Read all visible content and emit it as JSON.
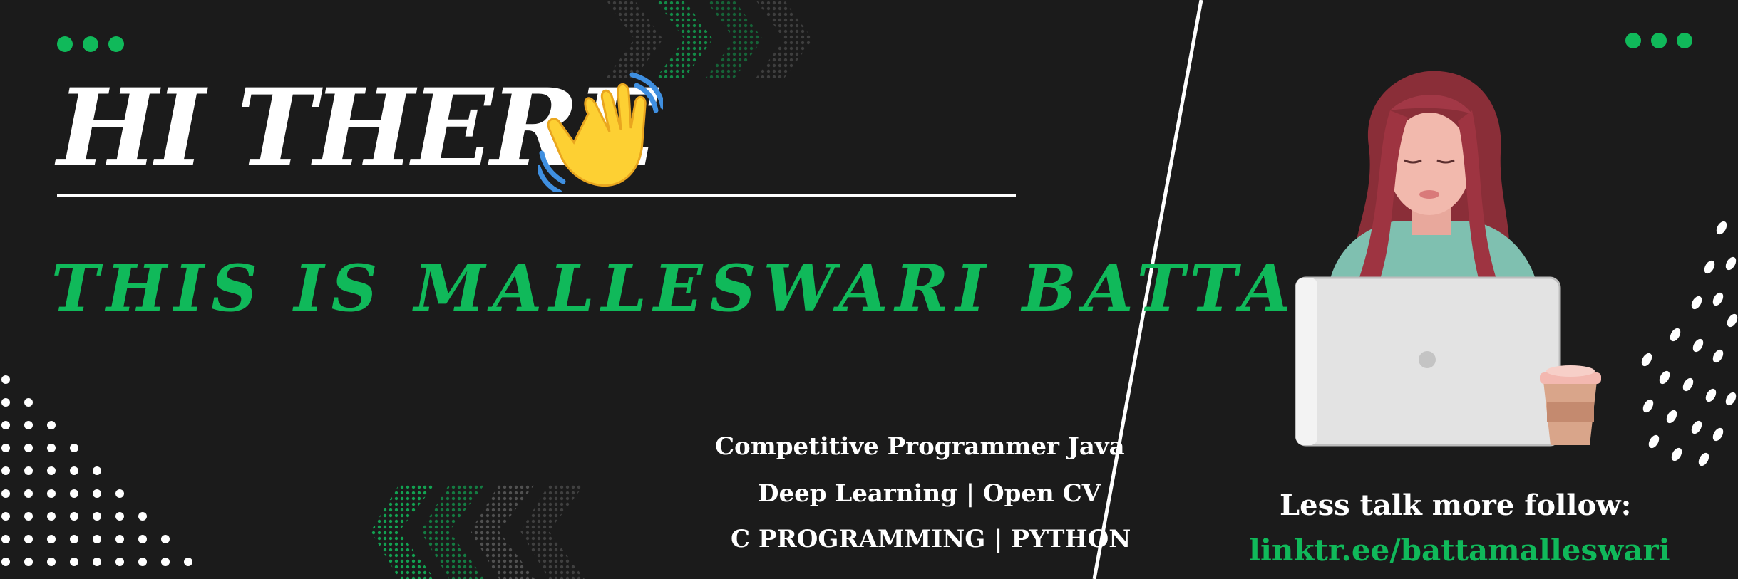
{
  "banner": {
    "greeting": "HI THERE",
    "intro": "THIS IS MALLESWARI BATTA",
    "skills": [
      "Competitive Programmer Java",
      "Deep Learning | Open CV",
      "C PROGRAMMING | PYTHON"
    ],
    "cta": "Less talk more follow:",
    "link": "linktr.ee/battamalleswari"
  },
  "icons": {
    "wave": "waving-hand-icon",
    "window_dots": "three-dots-icon",
    "illustration": "woman-with-laptop-illustration"
  },
  "colors": {
    "background": "#1b1b1b",
    "accent": "#10b95a",
    "text": "#ffffff"
  }
}
